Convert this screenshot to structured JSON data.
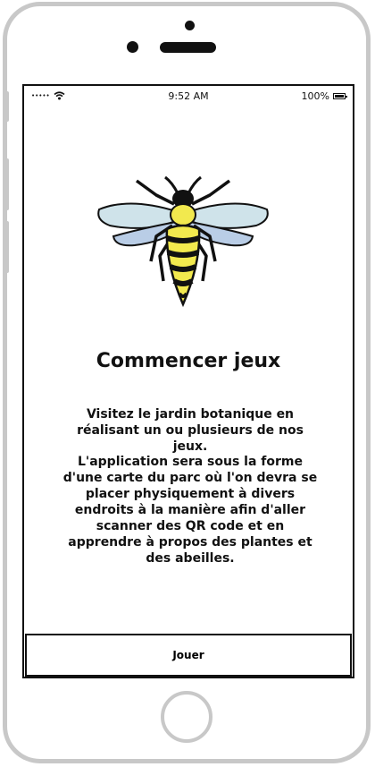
{
  "status_bar": {
    "time": "9:52 AM",
    "battery": "100%",
    "signal": "•••••"
  },
  "screen": {
    "title": "Commencer jeux",
    "paragraph_1": "Visitez le jardin botanique en réalisant un ou plusieurs de nos jeux.",
    "paragraph_2": "L'application sera sous la forme d'une carte du parc où l'on devra se placer physiquement à divers endroits à la manière afin d'aller scanner des QR code et en apprendre à propos des plantes et des abeilles.",
    "play_button": "Jouer"
  },
  "icons": {
    "logo": "bee-illustration",
    "wifi": "wifi-icon",
    "battery": "battery-icon"
  },
  "colors": {
    "bee_yellow": "#f2e94e",
    "wing_blue": "#cfe3ea"
  }
}
